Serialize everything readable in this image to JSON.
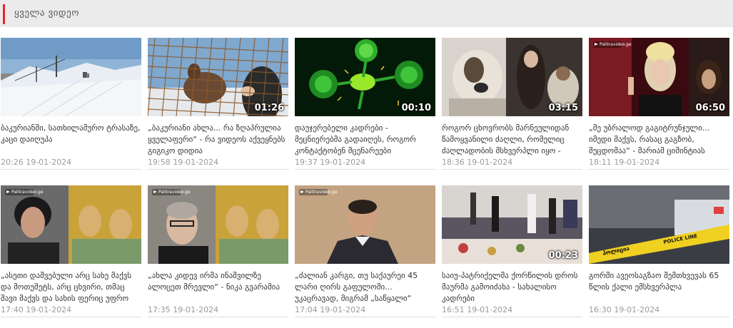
{
  "header": {
    "title": "ყველა ვიდეო",
    "accent": "#e8262b"
  },
  "videos": [
    {
      "caption": "ბაკურიანში, სათხილამურო ტრასაზე, კაცი დაიღუპა",
      "time": "20:26 19-01-2024",
      "duration": "",
      "thumb": "ski-slope"
    },
    {
      "caption": "„ბაკურიანი ახლა... რა ზღაპრულია ყველაფერი“ - რა ვიდეოს აქვეყნებს გიგიკო დიდია",
      "time": "19:58 19-01-2024",
      "duration": "01:26",
      "thumb": "deer-fence"
    },
    {
      "caption": "დაუჯერებელი კადრები - მეცნიერებმა გადაიღეს, როგორ კონტაქტობენ მცენარეები",
      "time": "19:37 19-01-2024",
      "duration": "00:10",
      "thumb": "green-plant"
    },
    {
      "caption": "როგორ ცხოვრობს მარნეულიდან წამოყვანილი ძაღლი, რომელიც ძაღლადობის მსხვერპლი იყო -",
      "time": "18:36 19-01-2024",
      "duration": "03:15",
      "thumb": "dogs"
    },
    {
      "caption": "„მე უბრალოდ გაგიტრუნჯული... იმედი მაქვს, რასაც გაგზობ, შეცდომაა“ - მარიამ ციმინტიას",
      "time": "18:11 19-01-2024",
      "duration": "06:50",
      "thumb": "woman-stage"
    },
    {
      "caption": "„ასეთი დაშვებული არც სახე მაქვს და მოთუშეტს, არც ცხვირი, თმაც შავი მაქვს და სახის ფერიც უფრო",
      "time": "17:40 19-01-2024",
      "duration": "",
      "thumb": "woman-fresco"
    },
    {
      "caption": "„ახლა კიდევ ირმა ინაშვილზე ალოცეთ მრევლი“ - ნიკა გვარამია",
      "time": "17:35 19-01-2024",
      "duration": "",
      "thumb": "man-fresco"
    },
    {
      "caption": "„ძალიან კარგი, თუ საქაურეი 45 ლარი ღირს გაფულომი... უკაცრავად, მიგრამ „საწყალი“",
      "time": "17:04 19-01-2024",
      "duration": "",
      "thumb": "man-portrait"
    },
    {
      "caption": "საიუ-პატრიქელმა ქორწილის დროს მაურმა გამოიძახა - სახალისო კადრები",
      "time": "16:51 19-01-2024",
      "duration": "00:23",
      "thumb": "wedding"
    },
    {
      "caption": "გორში ავეოსაგზაო შემთხვევას 65 წლის ქალი ემსხვერპლა",
      "time": "16:30 19-01-2024",
      "duration": "",
      "thumb": "police-tape"
    }
  ],
  "badges": {
    "logo_text": "Palitravideo.ge"
  },
  "police_tape_text": "POLICE LINE",
  "crime_scene_text": "პოლიცია"
}
